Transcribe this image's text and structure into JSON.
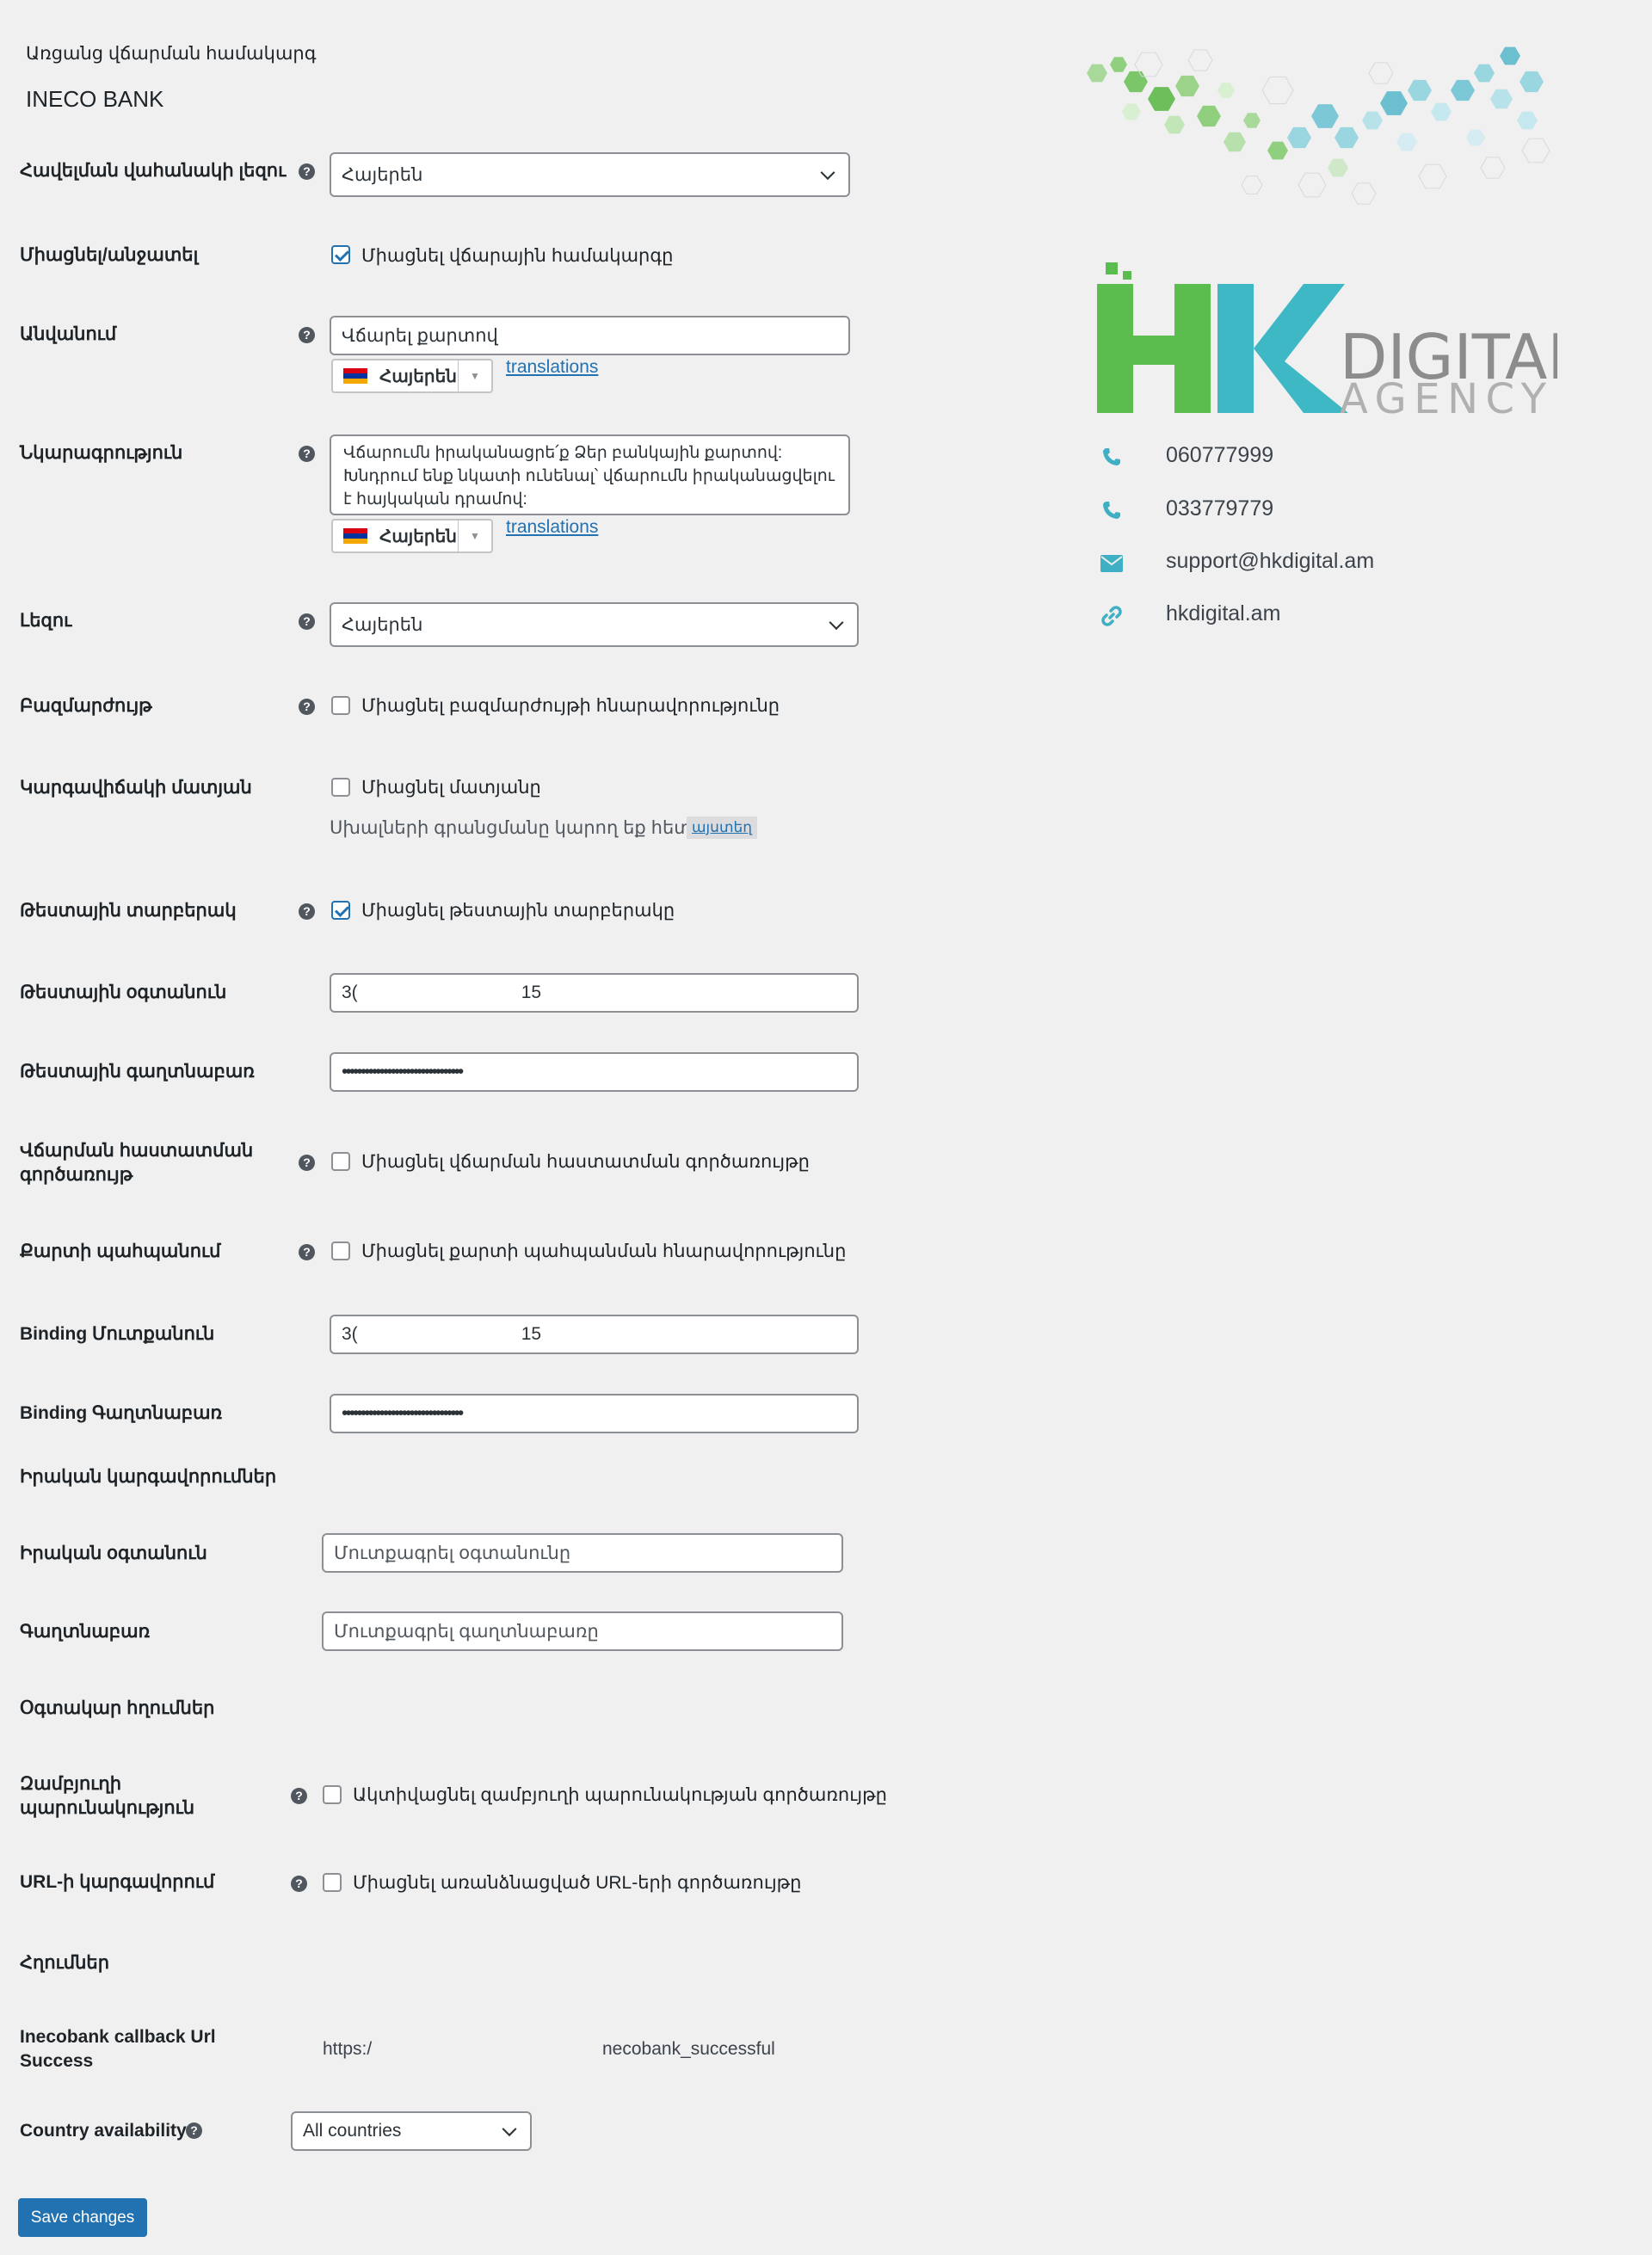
{
  "breadcrumb": "Առցանց վճարման համակարգ",
  "title": "INECO BANK",
  "fields": {
    "page_language": {
      "label": "Հավելման վահանակի լեզու",
      "value": "Հայերեն"
    },
    "enable": {
      "label": "Միացնել/անջատել",
      "checkbox": "Միացնել վճարային համակարգը",
      "checked": true
    },
    "name": {
      "label": "Անվանում",
      "value": "Վճարել քարտով",
      "lang": "Հայերեն",
      "link": "translations"
    },
    "description": {
      "label": "Նկարագրություն",
      "value": "Վճարումն իրականացրե՛ք Ձեր բանկային քարտով: Խնդրում ենք նկատի ունենալ՝ վճարումն իրականացվելու է հայկական դրամով:",
      "lang": "Հայերեն",
      "link": "translations"
    },
    "language": {
      "label": "Լեզու",
      "value": "Հայերեն"
    },
    "multicurrency": {
      "label": "Բազմարժույթ",
      "checkbox": "Միացնել բազմարժույթի հնարավորությունը",
      "checked": false
    },
    "debug_log": {
      "label": "Կարգավիճակի մատյան",
      "checkbox": "Միացնել մատյանը",
      "checked": false,
      "hint": "Սխալների գրանցմանը կարող եք հետևել",
      "hint_link": "այստեղ"
    },
    "test_mode": {
      "label": "Թեստային տարբերակ",
      "checkbox": "Միացնել թեստային տարբերակը",
      "checked": true
    },
    "test_user": {
      "label": "Թեստային օգտանուն",
      "value_start": "3(",
      "value_end": "15"
    },
    "test_password": {
      "label": "Թեստային գաղտնաբառ",
      "value": "••••••••••••••••••••••••••••••••"
    },
    "payment_confirm": {
      "label": "Վճարման հաստատման գործառույթ",
      "checkbox": "Միացնել վճարման հաստատման գործառույթը",
      "checked": false
    },
    "card_save": {
      "label": "Քարտի պահպանում",
      "checkbox": "Միացնել քարտի պահպանման հնարավորությունը",
      "checked": false
    },
    "binding_login": {
      "label": "Binding Մուտքանուն",
      "value_start": "3(",
      "value_end": "15"
    },
    "binding_password": {
      "label": "Binding Գաղտնաբառ",
      "value": "••••••••••••••••••••••••••••••••"
    }
  },
  "live_section": {
    "heading": "Իրական կարգավորումներ",
    "user": {
      "label": "Իրական օգտանուն",
      "placeholder": "Մուտքագրել օգտանունը"
    },
    "password": {
      "label": "Գաղտնաբառ",
      "placeholder": "Մուտքագրել գաղտնաբառը"
    }
  },
  "useful_section": {
    "heading": "Օգտակար հղումներ",
    "empty_cart": {
      "label": "Զամբյուղի պարունակություն",
      "checkbox": "Ակտիվացնել զամբյուղի պարունակության գործառույթը",
      "checked": false
    },
    "url_settings": {
      "label": "URL-ի կարգավորում",
      "checkbox": "Միացնել առանձնացված URL-երի գործառույթը",
      "checked": false
    }
  },
  "links_section": {
    "heading": "Հղումներ",
    "callback": {
      "label": "Inecobank callback Url Success",
      "url_start": "https:/",
      "url_end": "necobank_successful"
    }
  },
  "country": {
    "label": "Country availability",
    "value": "All countries"
  },
  "save_label": "Save changes",
  "contacts": [
    {
      "icon": "phone-icon",
      "text": "060777999"
    },
    {
      "icon": "phone-icon",
      "text": "033779779"
    },
    {
      "icon": "envelope-icon",
      "text": "support@hkdigital.am"
    },
    {
      "icon": "link-icon",
      "text": "hkdigital.am"
    }
  ],
  "logo": {
    "letters": "HK",
    "word1": "DIGITAL",
    "word2": "AGENCY"
  },
  "colors": {
    "accent": "#2271b1",
    "logo_green": "#5cbd4f",
    "logo_teal": "#3fb8c6",
    "logo_gray": "#8c8c8c",
    "icon_teal": "#3fb0c3"
  }
}
